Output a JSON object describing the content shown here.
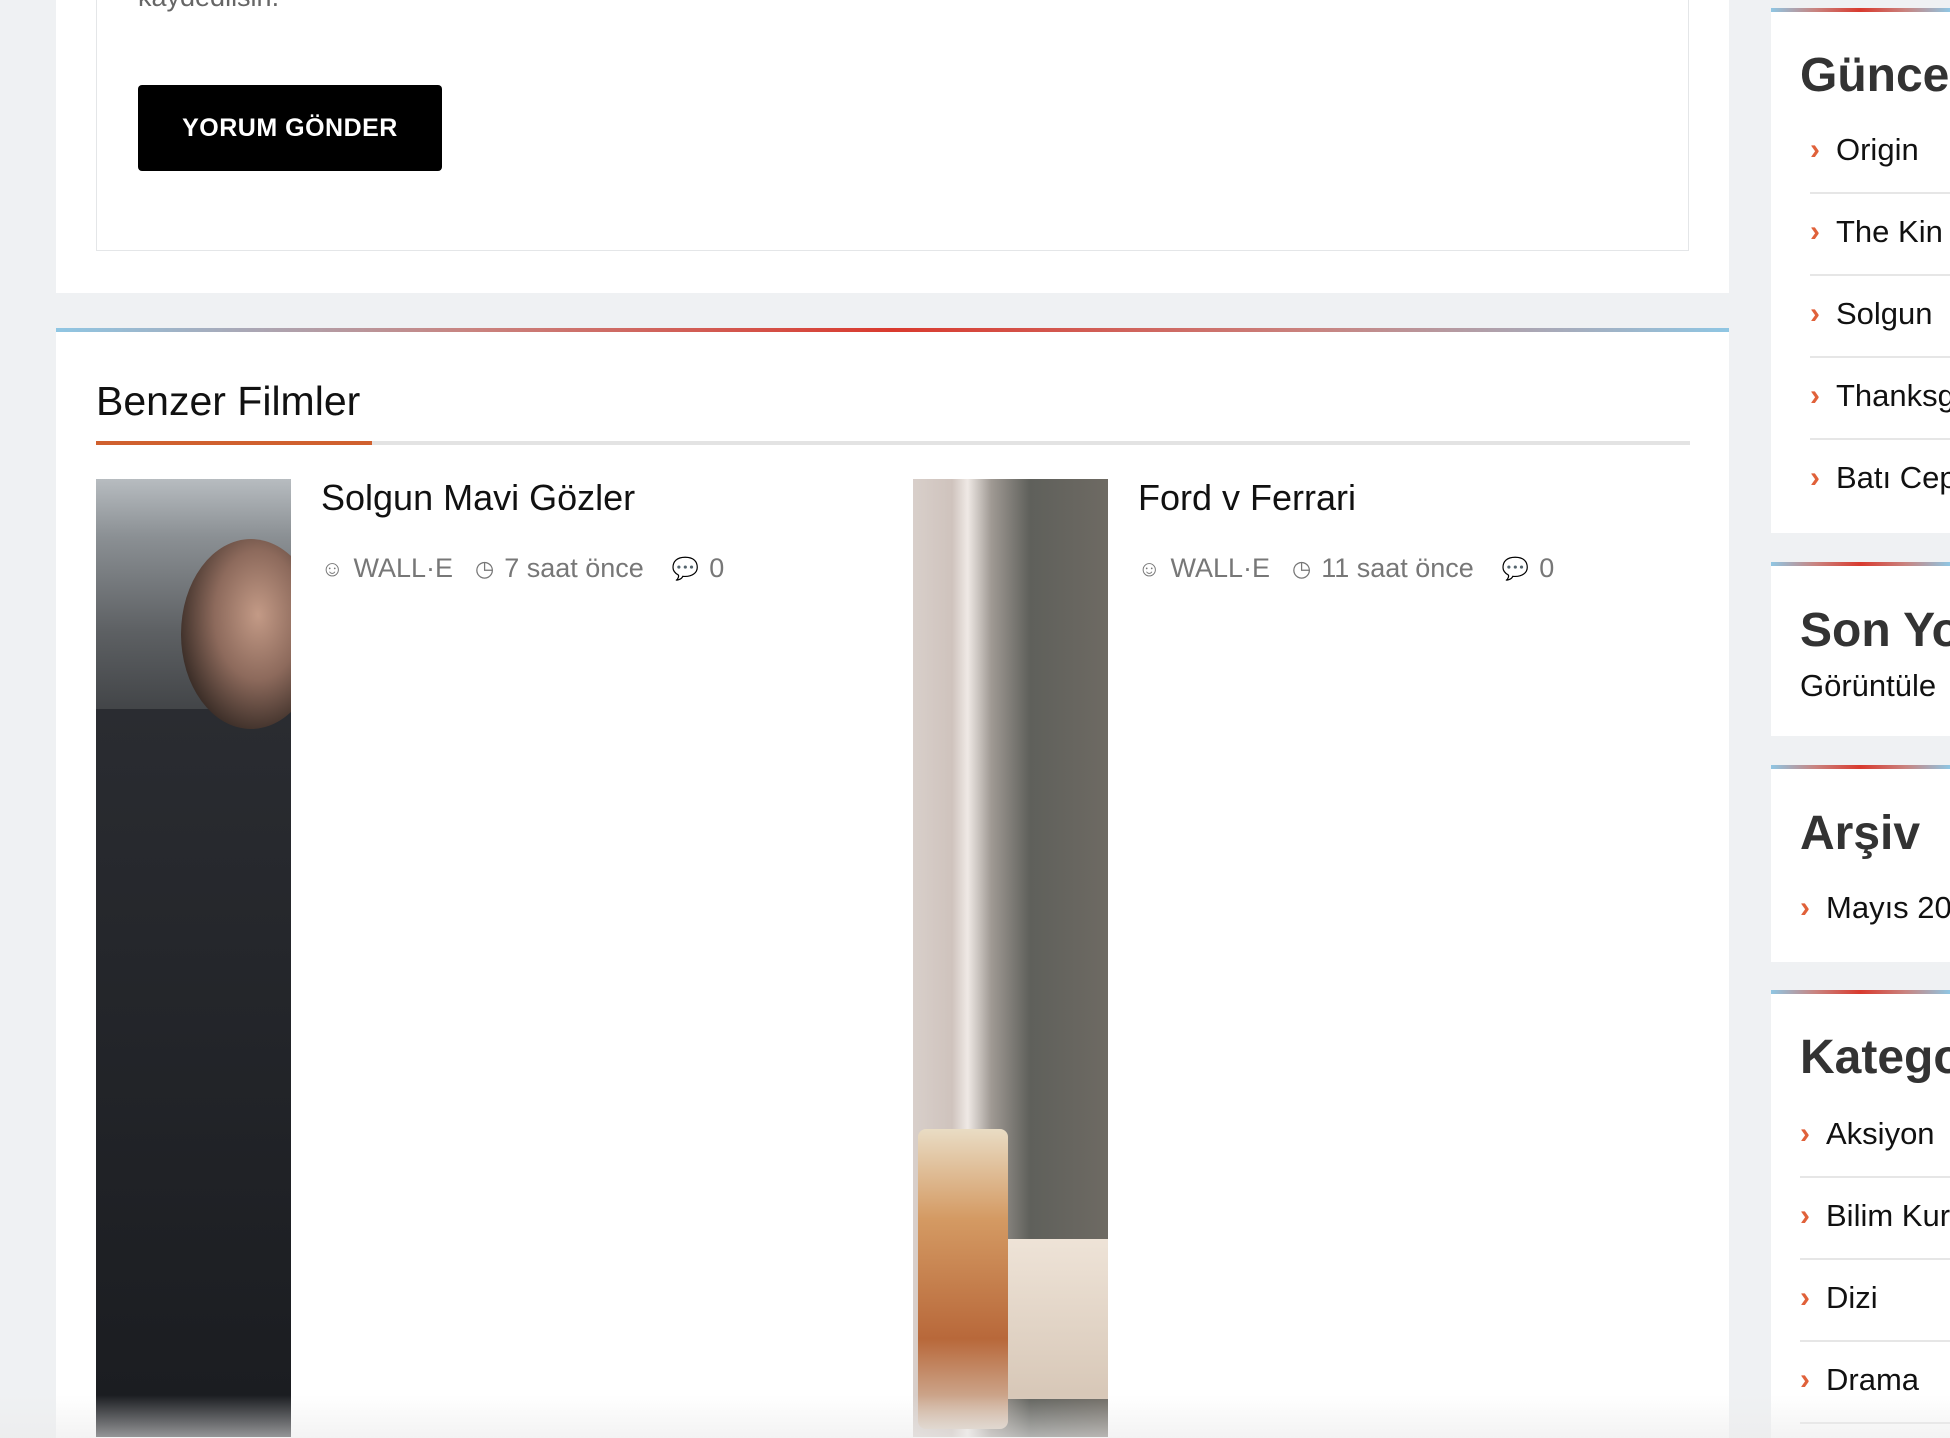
{
  "comment_form": {
    "cut_text": "kaydedilsin.",
    "submit_label": "YORUM GÖNDER"
  },
  "similar": {
    "title": "Benzer Filmler",
    "items": [
      {
        "title": "Solgun Mavi Gözler",
        "author": "WALL·E",
        "time": "7 saat önce",
        "comments": "0"
      },
      {
        "title": "Ford v Ferrari",
        "author": "WALL·E",
        "time": "11 saat önce",
        "comments": "0"
      }
    ]
  },
  "sidebar": {
    "recent": {
      "title": "Günce",
      "items": [
        "Origin",
        "The Kin",
        "Solgun",
        "Thanksg",
        "Batı Cep"
      ]
    },
    "comments": {
      "title": "Son Yo",
      "text": "Görüntüle"
    },
    "archive": {
      "title": "Arşiv",
      "items": [
        "Mayıs 20"
      ]
    },
    "categories": {
      "title": "Katego",
      "items": [
        "Aksiyon",
        "Bilim Kur",
        "Dizi",
        "Drama"
      ]
    }
  },
  "colors": {
    "accent": "#d0602e",
    "chevron": "#e0613a",
    "button_bg": "#000000"
  },
  "icons": {
    "author": "user-circle-icon",
    "time": "clock-icon",
    "comments": "comment-icon",
    "list_bullet": "chevron-right-icon"
  }
}
